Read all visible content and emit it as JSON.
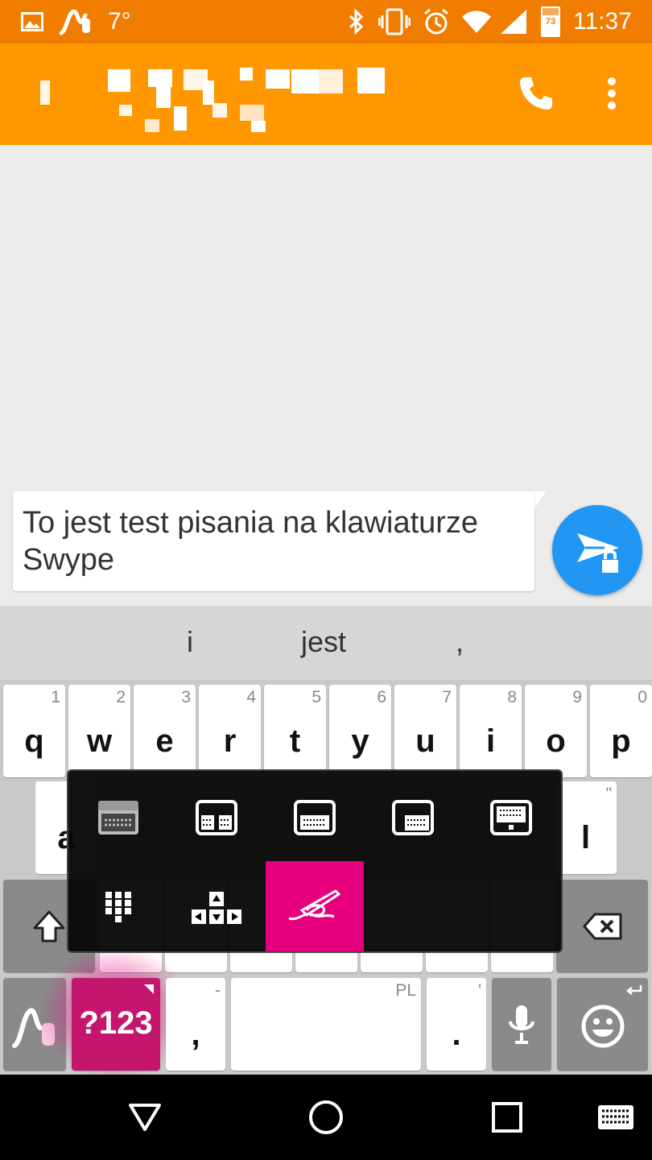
{
  "status_bar": {
    "temperature": "7°",
    "battery_level": "73",
    "time": "11:37",
    "icons": [
      "image-icon",
      "swype-icon",
      "bluetooth-icon",
      "vibrate-icon",
      "alarm-icon",
      "wifi-icon",
      "signal-icon",
      "battery-icon"
    ]
  },
  "app_bar": {
    "contact_name_redacted": true,
    "actions": [
      "phone-icon",
      "more-vert-icon"
    ],
    "colors": {
      "status": "#f07c00",
      "toolbar": "#ff9800"
    }
  },
  "compose": {
    "text": "To jest test pisania na klawiaturze Swype",
    "send_color": "#2196f3"
  },
  "suggestions": [
    "i",
    "jest",
    ","
  ],
  "keyboard": {
    "row1": [
      {
        "main": "q",
        "alt": "1"
      },
      {
        "main": "w",
        "alt": "2"
      },
      {
        "main": "e",
        "alt": "3"
      },
      {
        "main": "r",
        "alt": "4"
      },
      {
        "main": "t",
        "alt": "5"
      },
      {
        "main": "y",
        "alt": "6"
      },
      {
        "main": "u",
        "alt": "7"
      },
      {
        "main": "i",
        "alt": "8"
      },
      {
        "main": "o",
        "alt": "9"
      },
      {
        "main": "p",
        "alt": "0"
      }
    ],
    "row2_partial": [
      {
        "main": "a",
        "alt": ""
      },
      {
        "main": "l",
        "alt": "\""
      }
    ],
    "symbols_label": "?123",
    "comma_label": ",",
    "comma_alt": "-",
    "space_alt": "PL",
    "period_label": ".",
    "period_alt": "'",
    "accent_color": "#e6007e"
  },
  "keyboard_mode_panel": {
    "options": [
      "full-keyboard-icon",
      "split-keyboard-icon",
      "keyboard-dock-center-icon",
      "keyboard-dock-right-icon",
      "keyboard-monitor-icon",
      "number-pad-icon",
      "arrow-keys-icon",
      "handwriting-icon"
    ],
    "selected": "handwriting-icon"
  },
  "nav_bar": [
    "back-icon",
    "home-icon",
    "recents-icon",
    "keyboard-switch-icon"
  ]
}
